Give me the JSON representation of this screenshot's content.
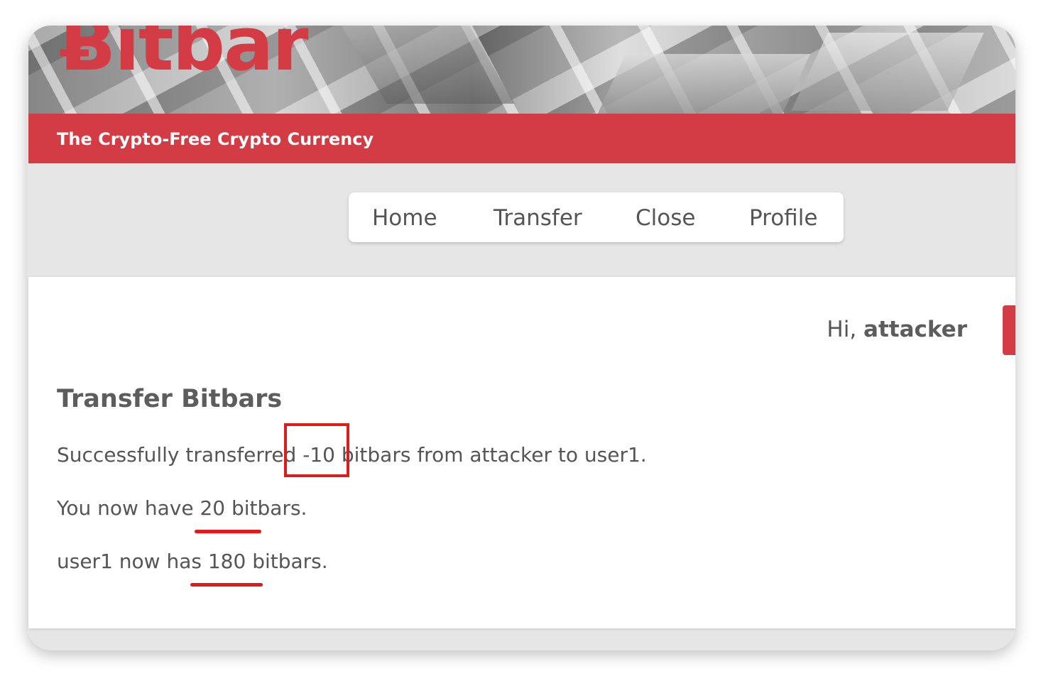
{
  "header": {
    "logo_text": "Ƀitbar",
    "tagline": "The Crypto-Free Crypto Currency"
  },
  "nav": {
    "items": [
      {
        "label": "Home"
      },
      {
        "label": "Transfer"
      },
      {
        "label": "Close"
      },
      {
        "label": "Profile"
      }
    ]
  },
  "user": {
    "greeting_prefix": "Hi,",
    "username": "attacker"
  },
  "main": {
    "title": "Transfer Bitbars",
    "messages": [
      "Successfully transferred -10 bitbars from attacker to user1.",
      "You now have 20 bitbars.",
      "user1 now has 180 bitbars."
    ]
  },
  "colors": {
    "brand": "#d33c45",
    "annotation": "#e01b1b"
  }
}
